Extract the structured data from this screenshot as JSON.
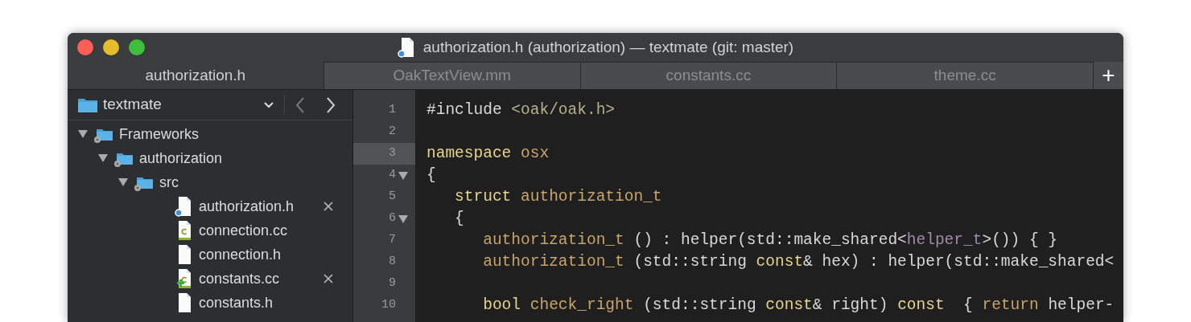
{
  "window": {
    "title": "authorization.h (authorization) — textmate (git: master)"
  },
  "tabs": [
    {
      "label": "authorization.h",
      "selected": true
    },
    {
      "label": "OakTextView.mm",
      "selected": false
    },
    {
      "label": "constants.cc",
      "selected": false
    },
    {
      "label": "theme.cc",
      "selected": false
    }
  ],
  "new_tab_button": "+",
  "sidebar": {
    "project": "textmate",
    "tree": [
      {
        "label": "Frameworks",
        "kind": "folder",
        "expanded": true,
        "children": [
          {
            "label": "authorization",
            "kind": "folder",
            "expanded": true,
            "children": [
              {
                "label": "src",
                "kind": "folder",
                "expanded": true,
                "children": [
                  {
                    "label": "authorization.h",
                    "kind": "header",
                    "open": true,
                    "added": false,
                    "closable": true
                  },
                  {
                    "label": "connection.cc",
                    "kind": "source",
                    "open": false,
                    "added": false,
                    "closable": false
                  },
                  {
                    "label": "connection.h",
                    "kind": "header",
                    "open": false,
                    "added": false,
                    "closable": false
                  },
                  {
                    "label": "constants.cc",
                    "kind": "source",
                    "open": false,
                    "added": true,
                    "closable": true
                  },
                  {
                    "label": "constants.h",
                    "kind": "header",
                    "open": false,
                    "added": false,
                    "closable": false
                  }
                ]
              }
            ]
          }
        ]
      }
    ]
  },
  "editor": {
    "lines": [
      {
        "number": "1",
        "current": false,
        "foldable": false,
        "tokens": [
          {
            "kind": "plain",
            "text": "#include "
          },
          {
            "kind": "string",
            "text": "<oak/oak.h>"
          }
        ]
      },
      {
        "number": "2",
        "current": false,
        "foldable": false
      },
      {
        "number": "3",
        "current": true,
        "foldable": false,
        "tokens": [
          {
            "kind": "keyword",
            "text": "namespace "
          },
          {
            "kind": "name",
            "text": "osx"
          }
        ]
      },
      {
        "number": "4",
        "current": false,
        "foldable": true,
        "tokens": [
          {
            "kind": "plain",
            "text": "{"
          }
        ]
      },
      {
        "number": "5",
        "current": false,
        "foldable": false,
        "tokens": [
          {
            "kind": "keyword",
            "text": "   struct "
          },
          {
            "kind": "name",
            "text": "authorization_t"
          }
        ]
      },
      {
        "number": "6",
        "current": false,
        "foldable": true,
        "tokens": [
          {
            "kind": "plain",
            "text": "   {"
          }
        ]
      },
      {
        "number": "7",
        "current": false,
        "foldable": false,
        "tokens": [
          {
            "kind": "name",
            "text": "      authorization_t"
          },
          {
            "kind": "plain",
            "text": " () : helper(std::make_shared<"
          },
          {
            "kind": "template",
            "text": "helper_t"
          },
          {
            "kind": "plain",
            "text": ">()) { }"
          }
        ]
      },
      {
        "number": "8",
        "current": false,
        "foldable": false,
        "tokens": [
          {
            "kind": "name",
            "text": "      authorization_t"
          },
          {
            "kind": "plain",
            "text": " (std::string "
          },
          {
            "kind": "keyword",
            "text": "const"
          },
          {
            "kind": "plain",
            "text": "& hex) : helper(std::make_shared<"
          }
        ]
      },
      {
        "number": "9",
        "current": false,
        "foldable": false
      },
      {
        "number": "10",
        "current": false,
        "foldable": false,
        "tokens": [
          {
            "kind": "keyword",
            "text": "      bool "
          },
          {
            "kind": "name",
            "text": "check_right"
          },
          {
            "kind": "plain",
            "text": " (std::string "
          },
          {
            "kind": "keyword",
            "text": "const"
          },
          {
            "kind": "plain",
            "text": "& right) "
          },
          {
            "kind": "keyword",
            "text": "const"
          },
          {
            "kind": "plain",
            "text": "  { "
          },
          {
            "kind": "name",
            "text": "return"
          },
          {
            "kind": "plain",
            "text": " helper-"
          }
        ]
      }
    ]
  }
}
